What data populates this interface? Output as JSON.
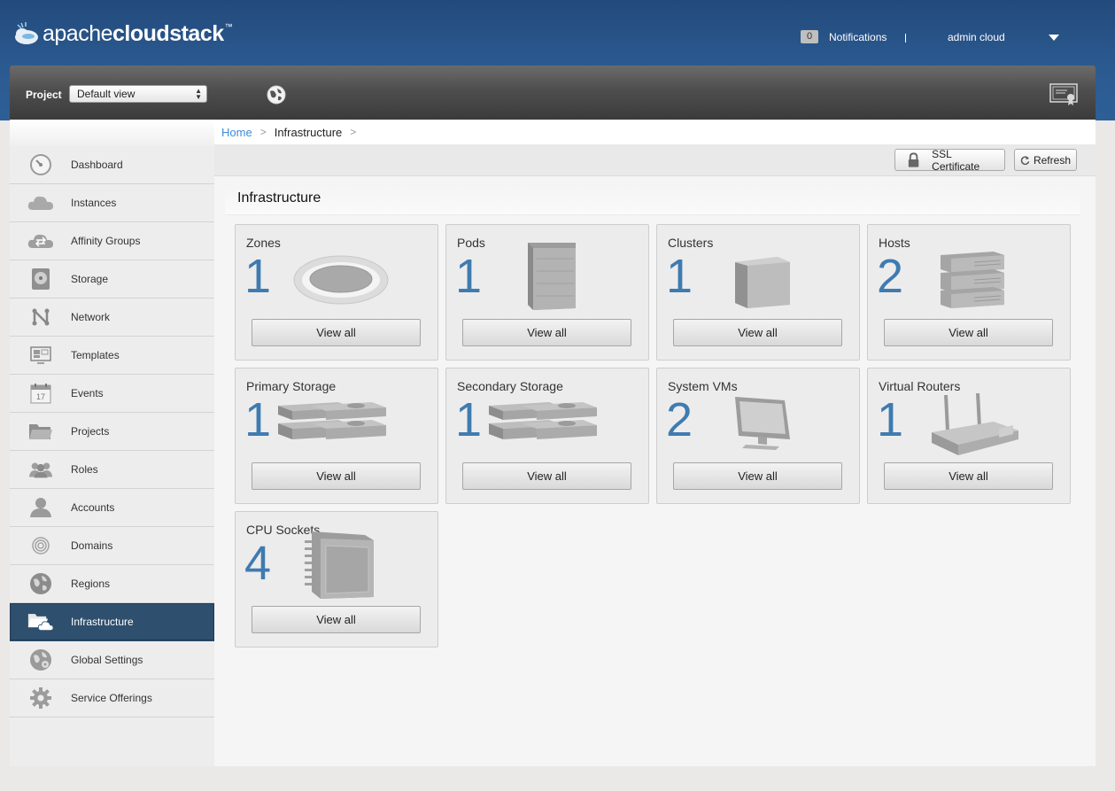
{
  "header": {
    "logo_light": "apache",
    "logo_bold": "cloudstack",
    "logo_tm": "™",
    "notifications_count": "0",
    "notifications_label": "Notifications",
    "user_name": "admin cloud"
  },
  "toolbar": {
    "project_label": "Project",
    "project_value": "Default view"
  },
  "sidebar": {
    "items": [
      {
        "label": "Dashboard",
        "icon": "dashboard-gauge-icon"
      },
      {
        "label": "Instances",
        "icon": "cloud-icon"
      },
      {
        "label": "Affinity Groups",
        "icon": "affinity-cloud-icon"
      },
      {
        "label": "Storage",
        "icon": "disk-icon"
      },
      {
        "label": "Network",
        "icon": "network-icon"
      },
      {
        "label": "Templates",
        "icon": "templates-icon"
      },
      {
        "label": "Events",
        "icon": "calendar-icon"
      },
      {
        "label": "Projects",
        "icon": "folder-icon"
      },
      {
        "label": "Roles",
        "icon": "roles-people-icon"
      },
      {
        "label": "Accounts",
        "icon": "user-icon"
      },
      {
        "label": "Domains",
        "icon": "target-icon"
      },
      {
        "label": "Regions",
        "icon": "globe-icon"
      },
      {
        "label": "Infrastructure",
        "icon": "folder-cloud-icon"
      },
      {
        "label": "Global Settings",
        "icon": "globe-settings-icon"
      },
      {
        "label": "Service Offerings",
        "icon": "gear-icon"
      }
    ],
    "active": "Infrastructure",
    "events_day": "17"
  },
  "breadcrumb": {
    "home": "Home",
    "separator": ">",
    "current": "Infrastructure"
  },
  "actions": {
    "ssl_label": "SSL Certificate",
    "refresh_label": "Refresh"
  },
  "section_title": "Infrastructure",
  "cards": [
    {
      "title": "Zones",
      "count": "1",
      "button": "View all"
    },
    {
      "title": "Pods",
      "count": "1",
      "button": "View all"
    },
    {
      "title": "Clusters",
      "count": "1",
      "button": "View all"
    },
    {
      "title": "Hosts",
      "count": "2",
      "button": "View all"
    },
    {
      "title": "Primary Storage",
      "count": "1",
      "button": "View all"
    },
    {
      "title": "Secondary Storage",
      "count": "1",
      "button": "View all"
    },
    {
      "title": "System VMs",
      "count": "2",
      "button": "View all"
    },
    {
      "title": "Virtual Routers",
      "count": "1",
      "button": "View all"
    },
    {
      "title": "CPU Sockets",
      "count": "4",
      "button": "View all"
    }
  ],
  "colors": {
    "header_blue": "#2b5a90",
    "count_blue": "#3f7bb0",
    "active_nav": "#2e4f6e",
    "link_blue": "#3d8bd9"
  }
}
